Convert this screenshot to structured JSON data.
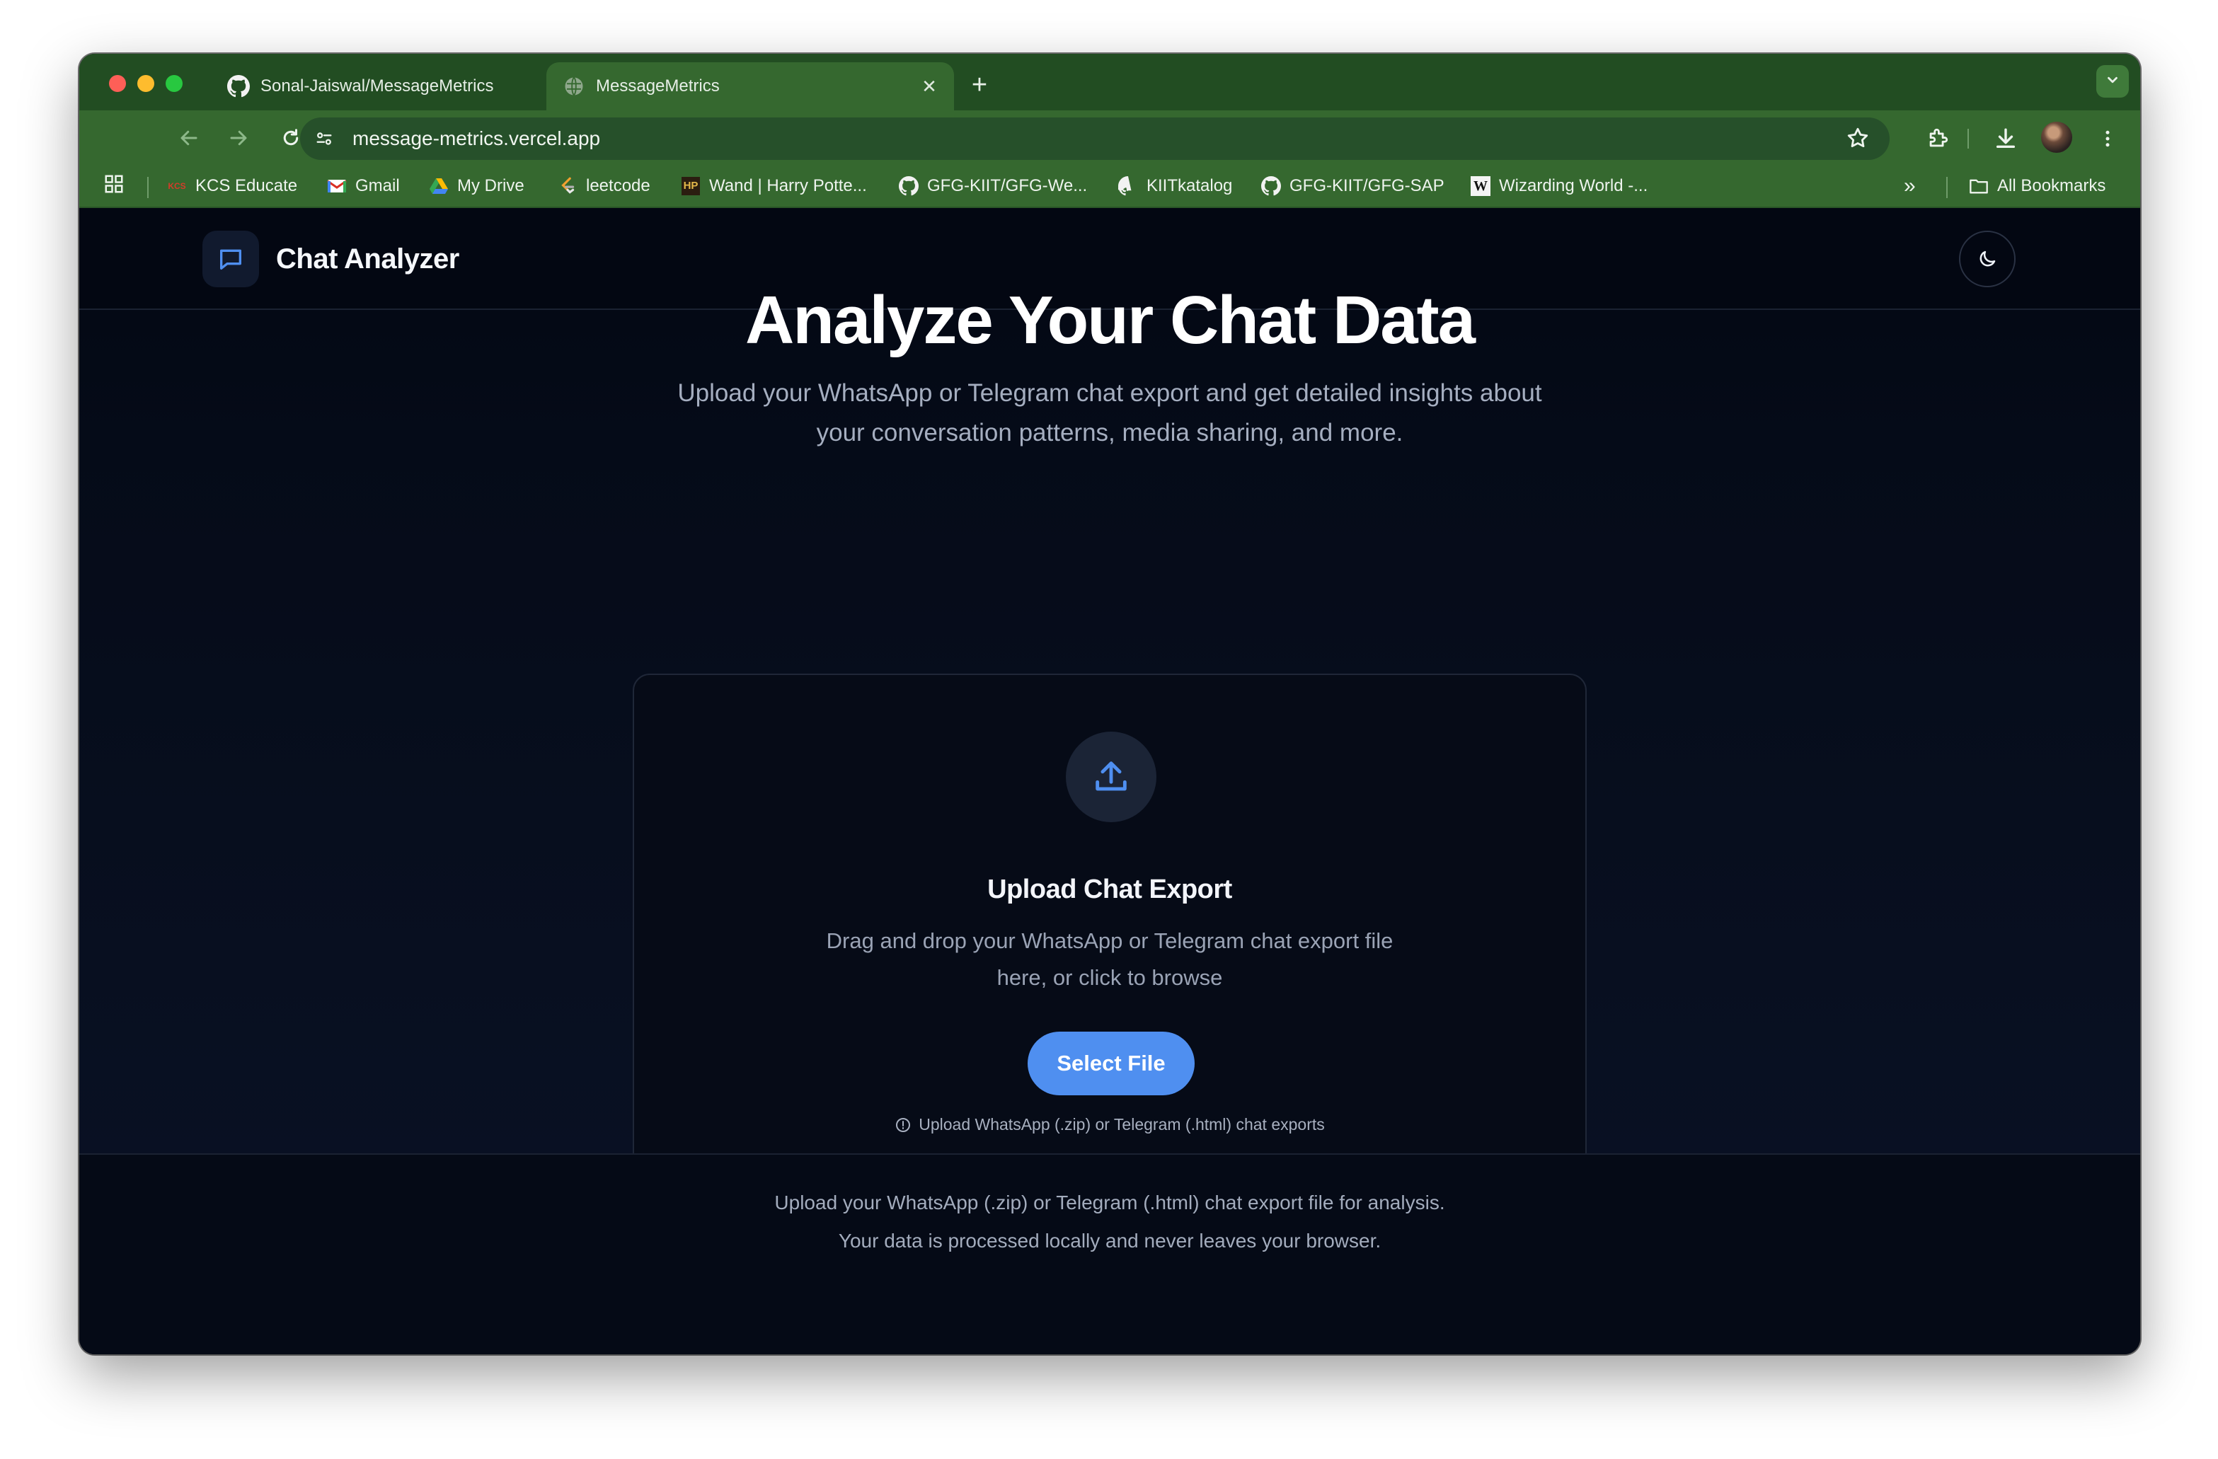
{
  "browser": {
    "tabs": [
      {
        "title": "Sonal-Jaiswal/MessageMetrics",
        "icon": "github-icon",
        "active": false
      },
      {
        "title": "MessageMetrics",
        "icon": "globe-icon",
        "active": true
      }
    ],
    "new_tab_label": "+",
    "url": "message-metrics.vercel.app",
    "bookmarks": [
      {
        "label": "KCS Educate",
        "icon": "kcs-icon"
      },
      {
        "label": "Gmail",
        "icon": "gmail-icon"
      },
      {
        "label": "My Drive",
        "icon": "drive-icon"
      },
      {
        "label": "leetcode",
        "icon": "leetcode-icon"
      },
      {
        "label": "Wand | Harry Potte...",
        "icon": "hp-icon"
      },
      {
        "label": "GFG-KIIT/GFG-We...",
        "icon": "github-icon"
      },
      {
        "label": "KIITkatalog",
        "icon": "github-icon"
      },
      {
        "label": "GFG-KIIT/GFG-SAP",
        "icon": "github-icon"
      },
      {
        "label": "Wizarding World -...",
        "icon": "w-icon"
      }
    ],
    "overflow_label": "»",
    "all_bookmarks_label": "All Bookmarks"
  },
  "app": {
    "brand": "Chat Analyzer",
    "hero_title": "Analyze Your Chat Data",
    "hero_subtitle_line1": "Upload your WhatsApp or Telegram chat export and get detailed insights about",
    "hero_subtitle_line2": "your conversation patterns, media sharing, and more.",
    "upload": {
      "title": "Upload Chat Export",
      "desc_line1": "Drag and drop your WhatsApp or Telegram chat export file",
      "desc_line2": "here, or click to browse",
      "button_label": "Select File",
      "note": "Upload WhatsApp (.zip) or Telegram (.html) chat exports"
    },
    "footer_line1": "Upload your WhatsApp (.zip) or Telegram (.html) chat export file for analysis.",
    "footer_line2": "Your data is processed locally and never leaves your browser."
  },
  "colors": {
    "browser_frame": "#35682f",
    "page_bg": "#030712",
    "accent": "#4f8ff0"
  }
}
